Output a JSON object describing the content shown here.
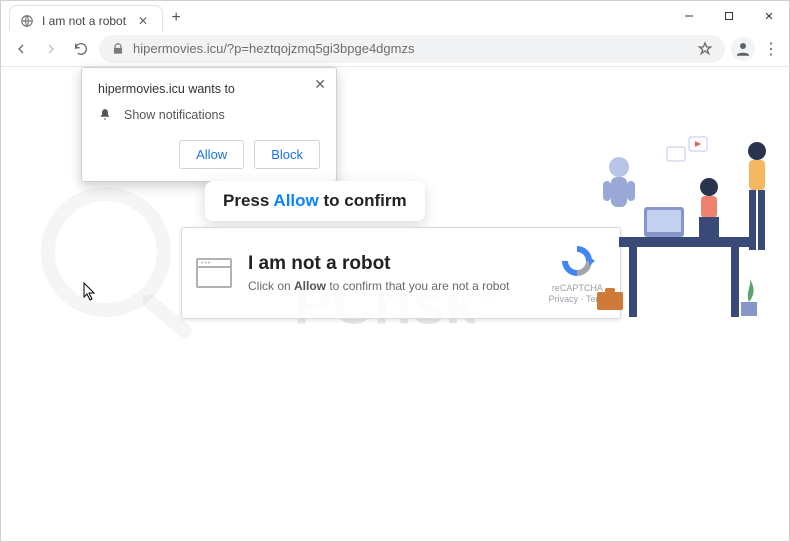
{
  "tab": {
    "title": "I am not a robot"
  },
  "address": {
    "url": "hipermovies.icu/?p=heztqojzmq5gi3bpge4dgmzs"
  },
  "permission": {
    "origin_text": "hipermovies.icu wants to",
    "line": "Show notifications",
    "allow": "Allow",
    "block": "Block"
  },
  "pill": {
    "pre": "Press ",
    "word": "Allow",
    "post": " to confirm"
  },
  "card": {
    "heading": "I am not a robot",
    "sub_pre": "Click on ",
    "sub_bold": "Allow",
    "sub_post": " to confirm that you are not a robot",
    "recaptcha": "reCAPTCHA",
    "privacy": "Privacy · Term"
  },
  "watermark": {
    "text": "PCrisk",
    "reg": "®"
  }
}
